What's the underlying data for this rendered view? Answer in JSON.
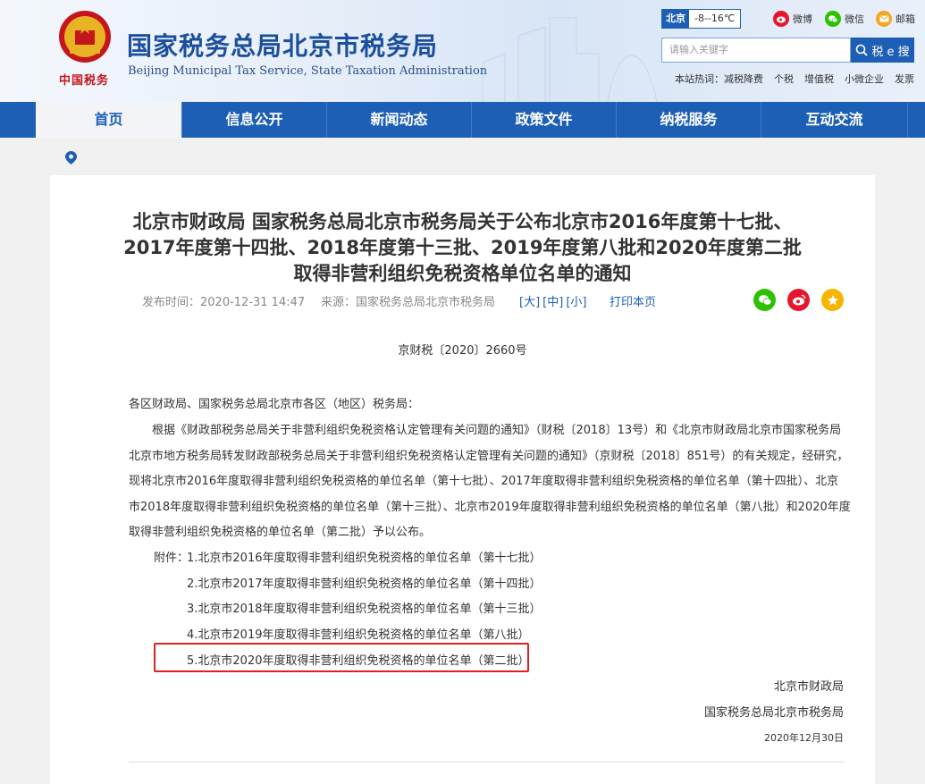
{
  "header": {
    "title": "国家税务总局北京市税务局",
    "subtitle": "Beijing Municipal Tax Service, State Taxation Administration",
    "brand_text": "中国税务",
    "weather": {
      "city": "北京",
      "temp": "-8--16℃"
    },
    "social": [
      {
        "label": "微博",
        "color": "#e6162d"
      },
      {
        "label": "微信",
        "color": "#2dc100"
      },
      {
        "label": "邮箱",
        "color": "#f5a623"
      }
    ],
    "search": {
      "placeholder": "请输入关键字",
      "button_label": "税 e 搜"
    },
    "hot": {
      "label": "本站热词：",
      "items": [
        "减税降费",
        "个税",
        "增值税",
        "小微企业",
        "发票"
      ]
    }
  },
  "nav": {
    "items": [
      "首页",
      "信息公开",
      "新闻动态",
      "政策文件",
      "纳税服务",
      "互动交流"
    ],
    "active_index": 0
  },
  "article": {
    "title_lines": [
      "北京市财政局 国家税务总局北京市税务局关于公布北京市2016年度第十七批、",
      "2017年度第十四批、2018年度第十三批、2019年度第八批和2020年度第二批",
      "取得非营利组织免税资格单位名单的通知"
    ],
    "publish_time": "发布时间：2020-12-31 14:47",
    "source": "来源：国家税务总局北京市税务局",
    "size_controls": [
      "[大]",
      "[中]",
      "[小]"
    ],
    "print_label": "打印本页",
    "doc_number": "京财税〔2020〕2660号",
    "salutation": "各区财政局、国家税务总局北京市各区（地区）税务局：",
    "body_lines": [
      "根据《财政部税务总局关于非营利组织免税资格认定管理有关问题的通知》（财税〔2018〕13号）和《北京市财政局北京市国家税务局",
      "北京市地方税务局转发财政部税务总局关于非营利组织免税资格认定管理有关问题的通知》（京财税〔2018〕851号）的有关规定，经研究，",
      "现将北京市2016年度取得非营利组织免税资格的单位名单（第十七批）、2017年度取得非营利组织免税资格的单位名单（第十四批）、北京",
      "市2018年度取得非营利组织免税资格的单位名单（第十三批）、北京市2019年度取得非营利组织免税资格的单位名单（第八批）和2020年度",
      "取得非营利组织免税资格的单位名单（第二批）予以公布。"
    ],
    "attachments_label": "附件：",
    "attachments": [
      "1.北京市2016年度取得非营利组织免税资格的单位名单（第十七批）",
      "2.北京市2017年度取得非营利组织免税资格的单位名单（第十四批）",
      "3.北京市2018年度取得非营利组织免税资格的单位名单（第十三批）",
      "4.北京市2019年度取得非营利组织免税资格的单位名单（第八批）",
      "5.北京市2020年度取得非营利组织免税资格的单位名单（第二批）"
    ],
    "signatures": [
      "北京市财政局",
      "国家税务总局北京市税务局"
    ],
    "date": "2020年12月30日"
  }
}
